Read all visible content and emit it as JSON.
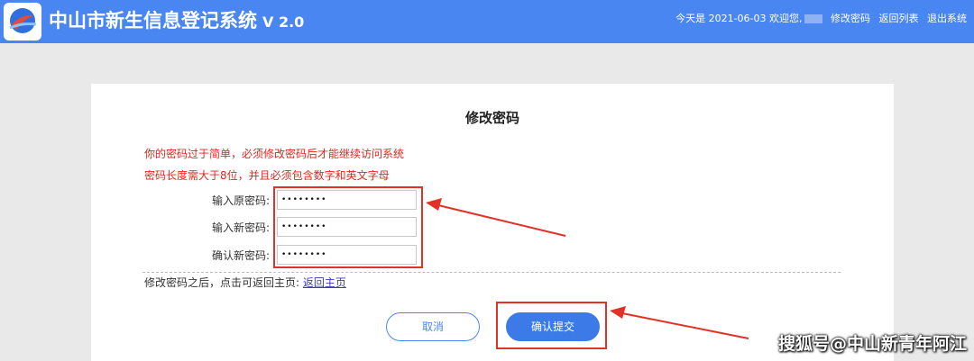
{
  "header": {
    "app_title": "中山市新生信息登记系统",
    "version": "V 2.0",
    "today_label": "今天是 2021-06-03 欢迎您,",
    "change_password_link": "修改密码",
    "back_to_list_link": "返回列表",
    "logout_link": "退出系统"
  },
  "form": {
    "title": "修改密码",
    "warning_line1": "你的密码过于简单，必须修改密码后才能继续访问系统",
    "warning_line2": "密码长度需大于8位，并且必须包含数字和英文字母",
    "fields": [
      {
        "label": "输入原密码:",
        "value": "••••••••"
      },
      {
        "label": "输入新密码:",
        "value": "••••••••"
      },
      {
        "label": "确认新密码:",
        "value": "••••••••"
      }
    ],
    "footnote_text": "修改密码之后，点击可返回主页: ",
    "home_link": "返回主页",
    "cancel_button": "取消",
    "submit_button": "确认提交"
  },
  "watermark": "搜狐号@中山新青年阿江",
  "colors": {
    "header_bg": "#4a86f2",
    "warning": "#e3261c",
    "annotation": "#e23227",
    "primary": "#3c7ae8"
  }
}
